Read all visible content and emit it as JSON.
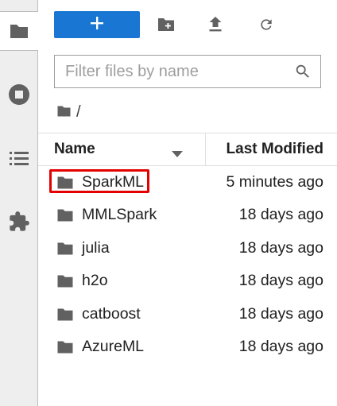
{
  "activity_bar": {
    "tabs": [
      {
        "icon": "folder-icon",
        "active": true
      },
      {
        "icon": "running-stop-icon",
        "active": false
      },
      {
        "icon": "list-icon",
        "active": false
      },
      {
        "icon": "extension-puzzle-icon",
        "active": false
      }
    ]
  },
  "toolbar": {
    "new_launcher_icon": "plus-icon",
    "buttons": [
      "new-folder-icon",
      "upload-icon",
      "refresh-icon"
    ]
  },
  "filter": {
    "placeholder": "Filter files by name",
    "value": ""
  },
  "breadcrumb": {
    "root_icon": "folder-icon",
    "path": "/"
  },
  "list_header": {
    "name": "Name",
    "modified": "Last Modified",
    "sort_icon": "caret-down-icon"
  },
  "files": [
    {
      "name": "SparkML",
      "modified": "5 minutes ago",
      "highlighted": true
    },
    {
      "name": "MMLSpark",
      "modified": "18 days ago"
    },
    {
      "name": "julia",
      "modified": "18 days ago"
    },
    {
      "name": "h2o",
      "modified": "18 days ago"
    },
    {
      "name": "catboost",
      "modified": "18 days ago"
    },
    {
      "name": "AzureML",
      "modified": "18 days ago"
    }
  ],
  "colors": {
    "accent": "#1976d2",
    "highlight": "#e30000",
    "icon": "#616161"
  }
}
